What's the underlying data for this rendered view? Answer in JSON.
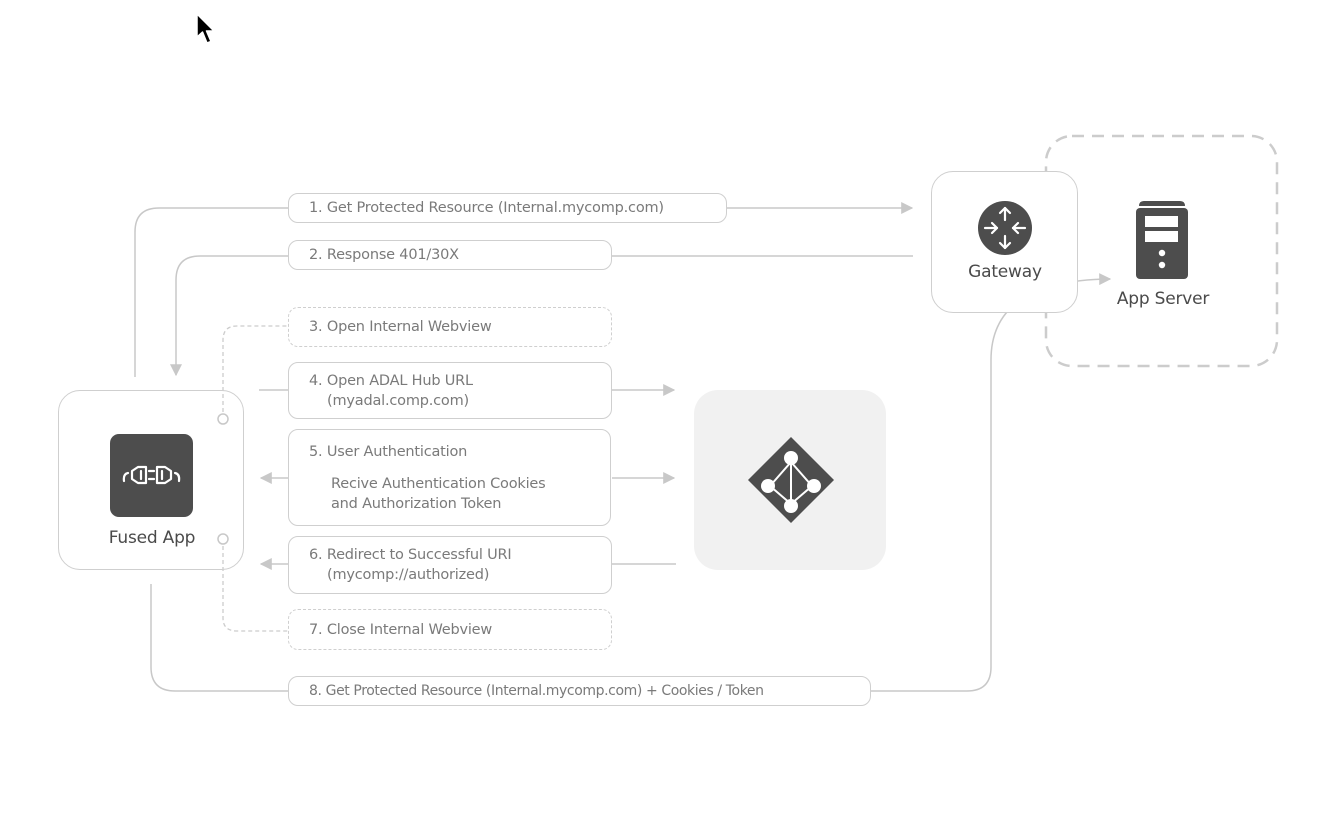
{
  "diagram": {
    "nodes": {
      "fused_app": {
        "label": "Fused App",
        "icon": "plug-connector-icon"
      },
      "gateway": {
        "label": "Gateway",
        "icon": "router-arrows-icon"
      },
      "app_server": {
        "label": "App Server",
        "icon": "server-tower-icon"
      },
      "adal_hub": {
        "label": "",
        "icon": "azure-active-directory-icon"
      }
    },
    "steps": [
      {
        "number": "1.",
        "text": "Get Protected Resource (Internal.mycomp.com)"
      },
      {
        "number": "2.",
        "text": "Response 401/30X"
      },
      {
        "number": "3.",
        "text": "Open Internal Webview"
      },
      {
        "number": "4.",
        "text": "Open ADAL Hub URL",
        "line2": "(myadal.comp.com)"
      },
      {
        "number": "5.",
        "text": "User Authentication",
        "sub1": "Recive Authentication Cookies",
        "sub2": "and Authorization Token"
      },
      {
        "number": "6.",
        "text": "Redirect to Successful URI",
        "line2": "(mycomp://authorized)"
      },
      {
        "number": "7.",
        "text": "Close Internal Webview"
      },
      {
        "number": "8.",
        "text": "Get Protected Resource (Internal.mycomp.com)  + Cookies / Token"
      }
    ],
    "colors": {
      "line": "#c8c8c8",
      "icon_fill": "#4d4d4d",
      "text": "#7a7a7a",
      "hub_bg": "#f1f1f1"
    }
  }
}
